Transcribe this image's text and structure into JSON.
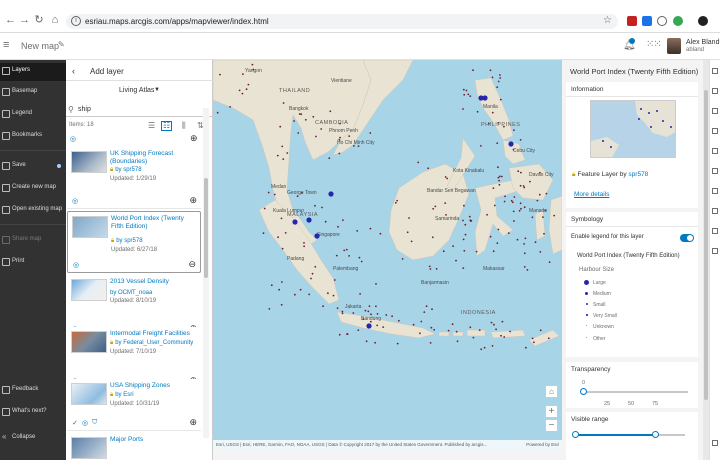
{
  "browser": {
    "url": "esriau.maps.arcgis.com/apps/mapviewer/index.html"
  },
  "header": {
    "title": "New map",
    "user_name": "Alex Bland",
    "user_id": "abland"
  },
  "sidebar": {
    "items": [
      {
        "label": "Layers"
      },
      {
        "label": "Basemap"
      },
      {
        "label": "Legend"
      },
      {
        "label": "Bookmarks"
      },
      {
        "label": "Save"
      },
      {
        "label": "Create new map"
      },
      {
        "label": "Open existing map"
      },
      {
        "label": "Share map"
      },
      {
        "label": "Print"
      },
      {
        "label": "Feedback"
      },
      {
        "label": "What's next?"
      },
      {
        "label": "Collapse"
      }
    ]
  },
  "add_layer": {
    "title": "Add layer",
    "source": "Living Atlas",
    "search_value": "ship",
    "items_count": "Items: 18",
    "results": [
      {
        "title": "UK Shipping Forecast (Boundaries)",
        "owner": "by spr578",
        "updated": "Updated: 1/29/19"
      },
      {
        "title": "World Port Index (Twenty Fifth Edition)",
        "owner": "by spr578",
        "updated": "Updated: 6/27/18"
      },
      {
        "title": "2013 Vessel Density",
        "owner": "by OCMT_noaa",
        "updated": "Updated: 8/10/19"
      },
      {
        "title": "Intermodal Freight Facilities",
        "owner": "by Federal_User_Community",
        "updated": "Updated: 7/10/19"
      },
      {
        "title": "USA Shipping Zones",
        "owner": "by Esri",
        "updated": "Updated: 10/31/19"
      },
      {
        "title": "Major Ports",
        "owner": "",
        "updated": ""
      }
    ]
  },
  "map": {
    "labels": [
      {
        "text": "Yangon"
      },
      {
        "text": "THAILAND"
      },
      {
        "text": "Vientiane"
      },
      {
        "text": "Bangkok"
      },
      {
        "text": "CAMBODIA"
      },
      {
        "text": "Phnom Penh"
      },
      {
        "text": "Ho Chi Minh City"
      },
      {
        "text": "PHILIPPINES"
      },
      {
        "text": "Manila"
      },
      {
        "text": "Cebu City"
      },
      {
        "text": "Davao City"
      },
      {
        "text": "George Town"
      },
      {
        "text": "Kuala Lumpur"
      },
      {
        "text": "MALAYSIA"
      },
      {
        "text": "Singapore"
      },
      {
        "text": "Padang"
      },
      {
        "text": "Palembang"
      },
      {
        "text": "Jakarta"
      },
      {
        "text": "Bandung"
      },
      {
        "text": "INDONESIA"
      },
      {
        "text": "Samarinda"
      },
      {
        "text": "Makassar"
      },
      {
        "text": "Banjarmasin"
      },
      {
        "text": "Kota Kinabalu"
      },
      {
        "text": "Bandar Seri Begawan"
      },
      {
        "text": "Medan"
      },
      {
        "text": "Manado"
      }
    ],
    "attribution": "Esri, USGS | Esri, HERE, Garmin, FAO, NOAA, USGS | Data © Copyright 2017 by the United States Government. Published by arcgis...",
    "powered": "Powered by Esri",
    "colors": {
      "water": "#a8d4e8",
      "land": "#e9e3d3",
      "port": "#2626ab"
    }
  },
  "details": {
    "title": "World Port Index (Twenty Fifth Edition)",
    "information_heading": "Information",
    "feature_layer_prefix": "Feature Layer by",
    "feature_layer_owner": "spr578",
    "more_details": "More details",
    "symbology_heading": "Symbology",
    "enable_legend": "Enable legend for this layer",
    "legend_title": "World Port Index (Twenty Fifth Edition)",
    "legend_field": "Harbour Size",
    "legend_items": [
      "Large",
      "Medium",
      "Small",
      "Very Small",
      "Unknown",
      "Other"
    ],
    "transparency_heading": "Transparency",
    "transparency_value": "0",
    "transparency_ticks": [
      "25",
      "50",
      "75"
    ],
    "visible_range_heading": "Visible range"
  }
}
